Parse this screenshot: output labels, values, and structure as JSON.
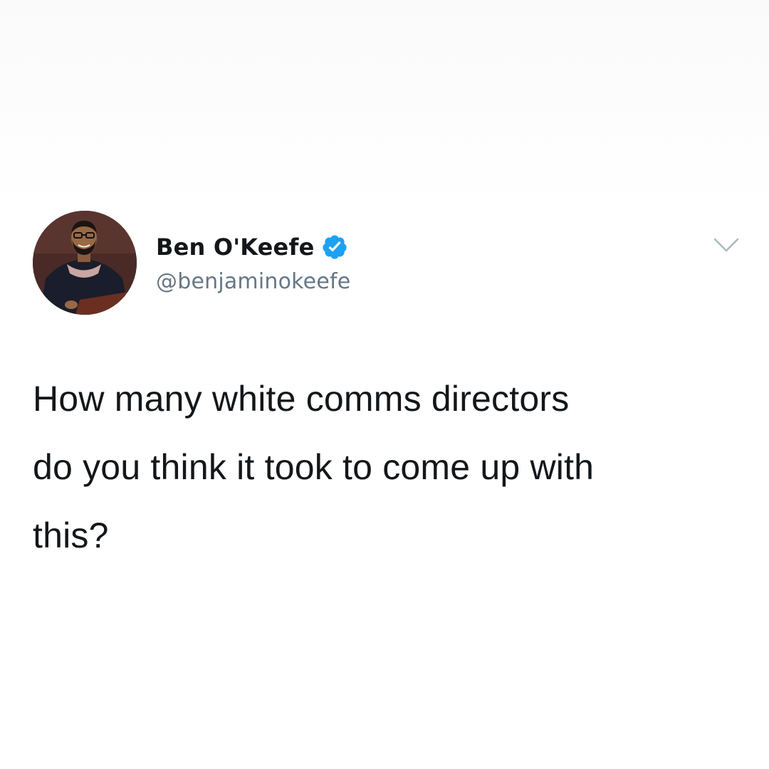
{
  "tweet": {
    "author": {
      "display_name": "Ben O'Keefe",
      "handle": "@benjaminokeefe",
      "verified": true,
      "avatar_icon": "profile-photo"
    },
    "text": "How many white comms directors\ndo you think it took to come up with\nthis?",
    "menu_icon": "chevron-down-icon"
  },
  "colors": {
    "background": "#ffffff",
    "name_text": "#14171a",
    "handle_text": "#657786",
    "verified_blue": "#1da1f2",
    "caret_gray": "#aab8c2"
  }
}
